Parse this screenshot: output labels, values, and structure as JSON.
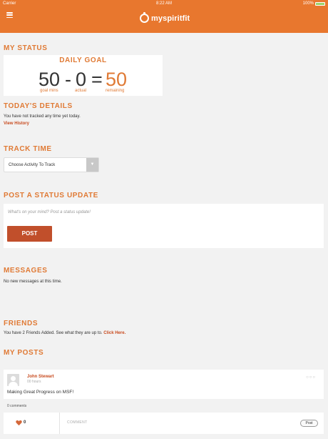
{
  "status_bar": {
    "carrier": "Carrier",
    "time": "8:22 AM",
    "battery": "100%"
  },
  "nav": {
    "menu_icon": "hamburger-icon",
    "logo_text": "myspiritfit",
    "logo_icon": "stopwatch-icon"
  },
  "my_status": {
    "title": "MY STATUS",
    "card_title": "DAILY GOAL",
    "goal_value": "50",
    "goal_caption": "goal mins",
    "minus": "-",
    "actual_value": "0",
    "actual_caption": "actual",
    "equals": "=",
    "remaining_value": "50",
    "remaining_caption": "remaining"
  },
  "todays_details": {
    "title": "TODAY'S DETAILS",
    "message": "You have not tracked any time yet today.",
    "link": "View History"
  },
  "track_time": {
    "title": "TRACK TIME",
    "select_value": "Choose Activity To Track",
    "arrow": "▼"
  },
  "status_update": {
    "title": "POST A STATUS UPDATE",
    "placeholder": "What's on your mind? Post a status update!",
    "button": "POST"
  },
  "messages": {
    "title": "MESSAGES",
    "message": "No new messages at this time."
  },
  "friends": {
    "title": "FRIENDS",
    "message": "You have 2 Friends Added. See what they are up to.",
    "link": "Click Here."
  },
  "my_posts": {
    "title": "MY POSTS",
    "post": {
      "author": "John Stewart",
      "meta": "00 hours",
      "body": "Making Great Progress on MSF!",
      "menu": "○○○",
      "comments": "0 comments",
      "likes": "0",
      "comment_placeholder": "COMMENT",
      "post_button": "Post"
    }
  },
  "colors": {
    "brand": "#e8772e",
    "accent_text": "#e07a35",
    "button": "#c14f2b",
    "link": "#c84b1f"
  }
}
